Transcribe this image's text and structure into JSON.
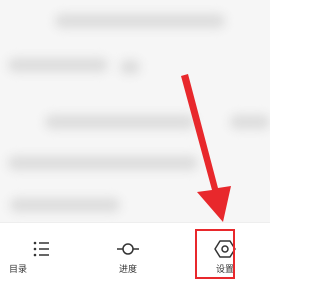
{
  "toolbar": {
    "toc_label": "目录",
    "progress_label": "进度",
    "settings_label": "设置"
  },
  "icons": {
    "toc": "list-icon",
    "progress": "progress-icon",
    "settings": "hexagon-settings-icon"
  },
  "colors": {
    "highlight": "#e8282c",
    "text": "#333333"
  }
}
